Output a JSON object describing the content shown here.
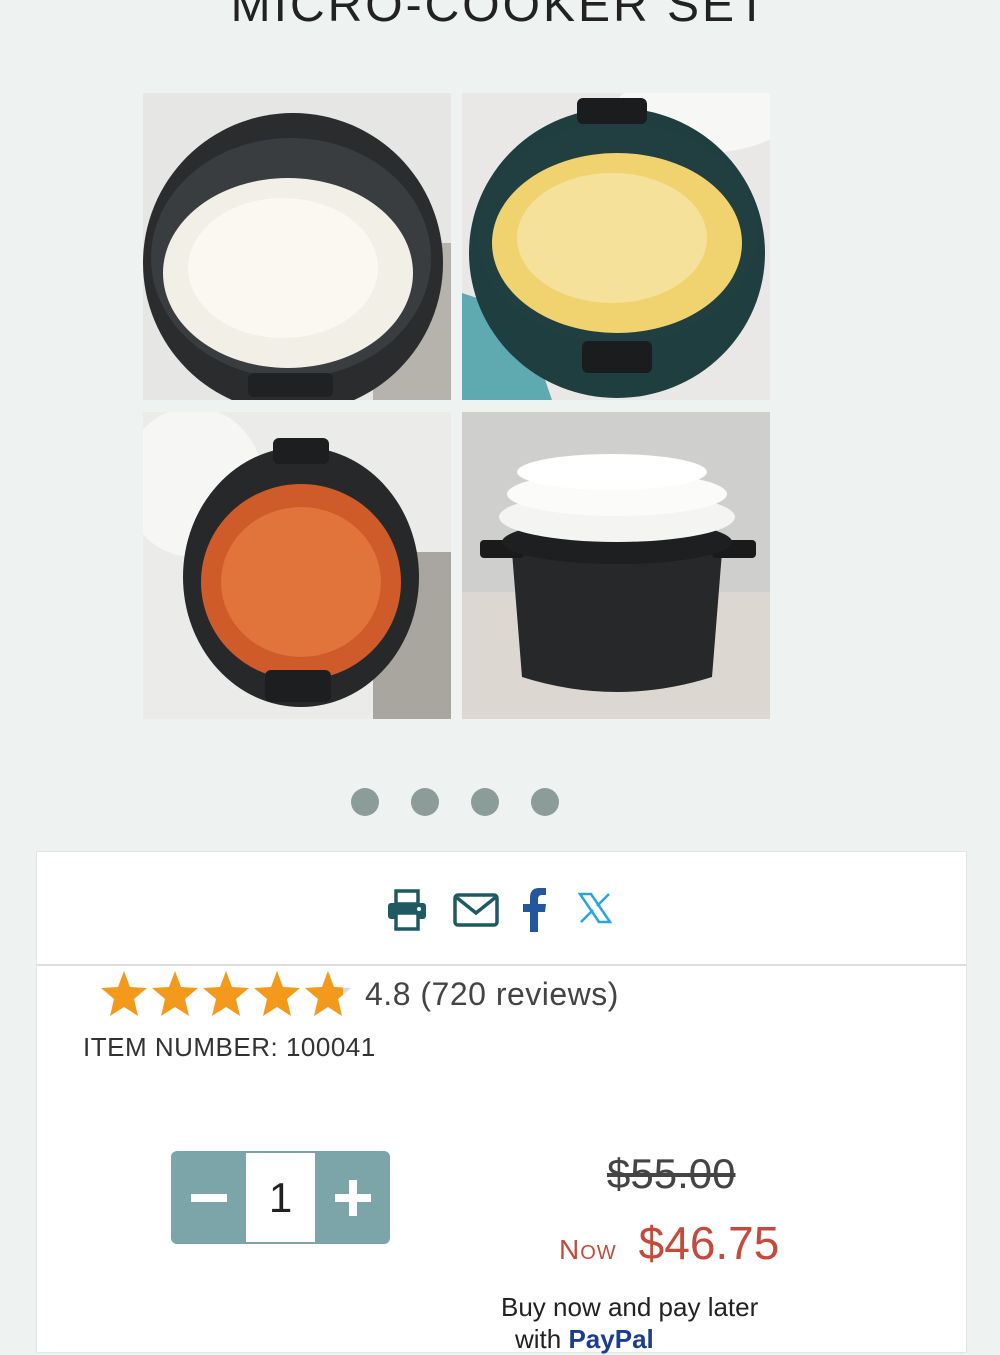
{
  "product": {
    "title": "MICRO-COOKER SET",
    "rating_value": 4.8,
    "rating_text": "4.8 (720 reviews)",
    "item_number": "ITEM NUMBER: 100041",
    "quantity": "1",
    "old_price": "$55.00",
    "now_label": "Now",
    "now_price": "$46.75",
    "bnpl_line1": "Buy now and pay later",
    "bnpl_line2_prefix": "with ",
    "bnpl_line2_brand": "PayPal"
  },
  "gallery": {
    "slides": [
      "rice-bowl-image",
      "mashed-potato-image",
      "carrot-fries-image",
      "cooker-set-image"
    ],
    "dots": 4
  },
  "share": {
    "icons": [
      "printer-icon",
      "envelope-icon",
      "facebook-icon",
      "x-icon"
    ]
  },
  "colors": {
    "accent_teal": "#7ca5a9",
    "share_teal": "#1f5a63",
    "star_orange": "#f39a1d",
    "price_red": "#c44a3c",
    "x_blue": "#2aa3e6",
    "page_bg": "#eef3f1"
  }
}
